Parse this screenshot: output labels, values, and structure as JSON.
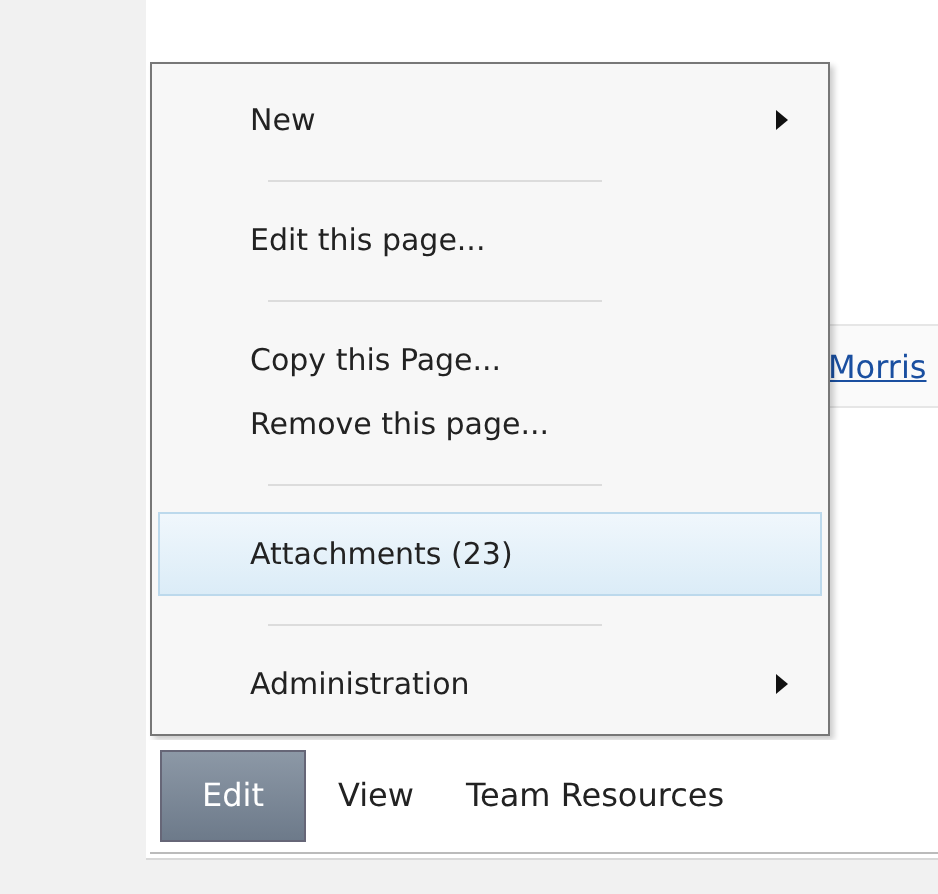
{
  "link": "Morris",
  "menu": [
    {
      "label": "New",
      "submenu": true,
      "selected": false,
      "separator_after": true
    },
    {
      "label": "Edit this page...",
      "submenu": false,
      "selected": false,
      "separator_after": true
    },
    {
      "label": "Copy this Page...",
      "submenu": false,
      "selected": false,
      "separator_after": false
    },
    {
      "label": "Remove this page...",
      "submenu": false,
      "selected": false,
      "separator_after": true
    },
    {
      "label": "Attachments (23)",
      "submenu": false,
      "selected": true,
      "separator_after": true
    },
    {
      "label": "Administration",
      "submenu": true,
      "selected": false,
      "separator_after": false
    }
  ],
  "menubar": [
    {
      "label": "Edit",
      "selected": true
    },
    {
      "label": "View",
      "selected": false
    },
    {
      "label": "Team Resources",
      "selected": false
    }
  ]
}
